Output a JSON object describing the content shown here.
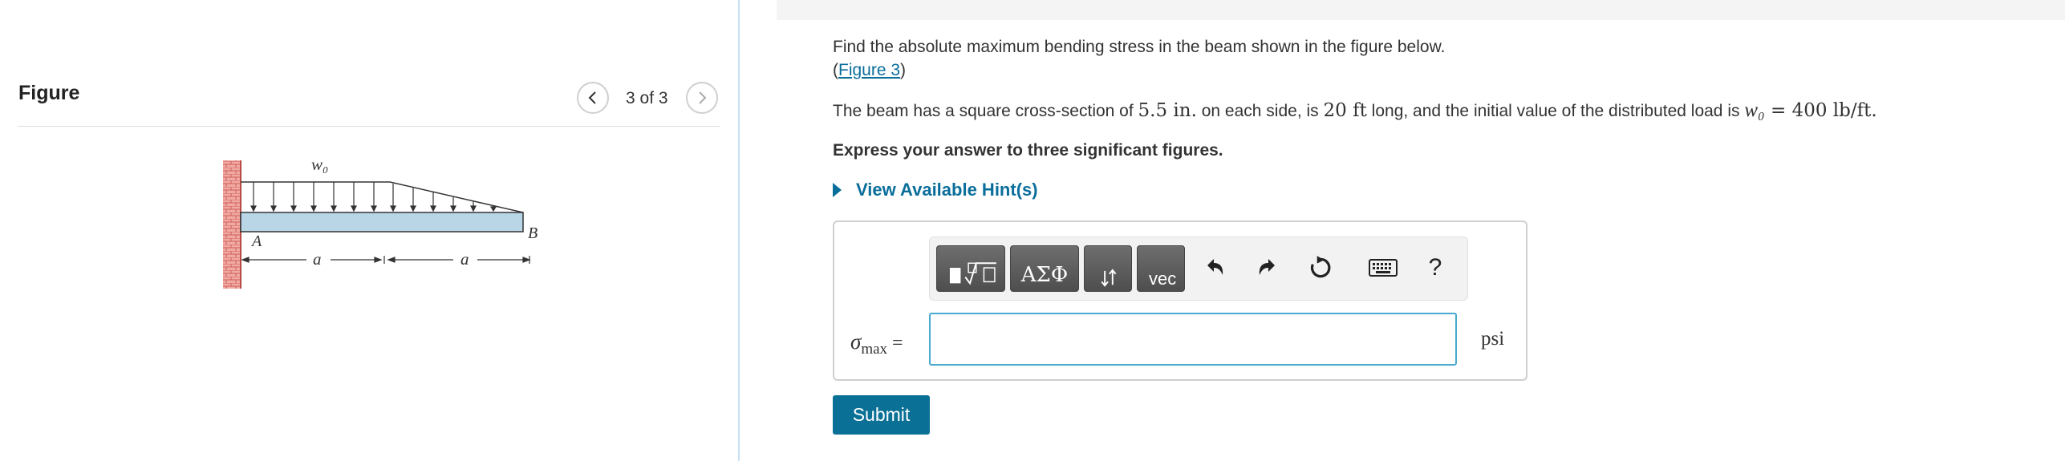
{
  "figure_panel": {
    "title": "Figure",
    "counter": "3 of 3",
    "diagram": {
      "load_label": "w₀",
      "point_a_label": "A",
      "point_b_label": "B",
      "dim_left_label": "a",
      "dim_right_label": "a"
    }
  },
  "problem": {
    "statement": "Find the absolute maximum bending stress in the beam shown in the figure below.",
    "figure_link_open": "(",
    "figure_link_text": "Figure 3",
    "figure_link_close": ")",
    "given_prefix": "The beam has a square cross-section of ",
    "side_value": "5.5 in.",
    "given_mid1": " on each side, is ",
    "length_value": "20 ft",
    "given_mid2": " long, and the initial value of the distributed load is ",
    "load_symbol": "w₀",
    "load_value": " = 400 lb/ft.",
    "instruction": "Express your answer to three significant figures.",
    "hints_label": "View Available Hint(s)"
  },
  "answer": {
    "toolbar": {
      "greek_label": "ΑΣΦ",
      "vector_label": "vec",
      "help_label": "?"
    },
    "sigma_symbol": "σ",
    "sigma_subscript": "max",
    "equals": "=",
    "input_value": "",
    "unit": "psi",
    "submit_label": "Submit"
  },
  "colors": {
    "accent": "#0a7096",
    "link": "#0a6e9b",
    "input_border": "#4aa9cf",
    "beam_fill": "#b9d6e6",
    "wall": "#e07a74"
  }
}
